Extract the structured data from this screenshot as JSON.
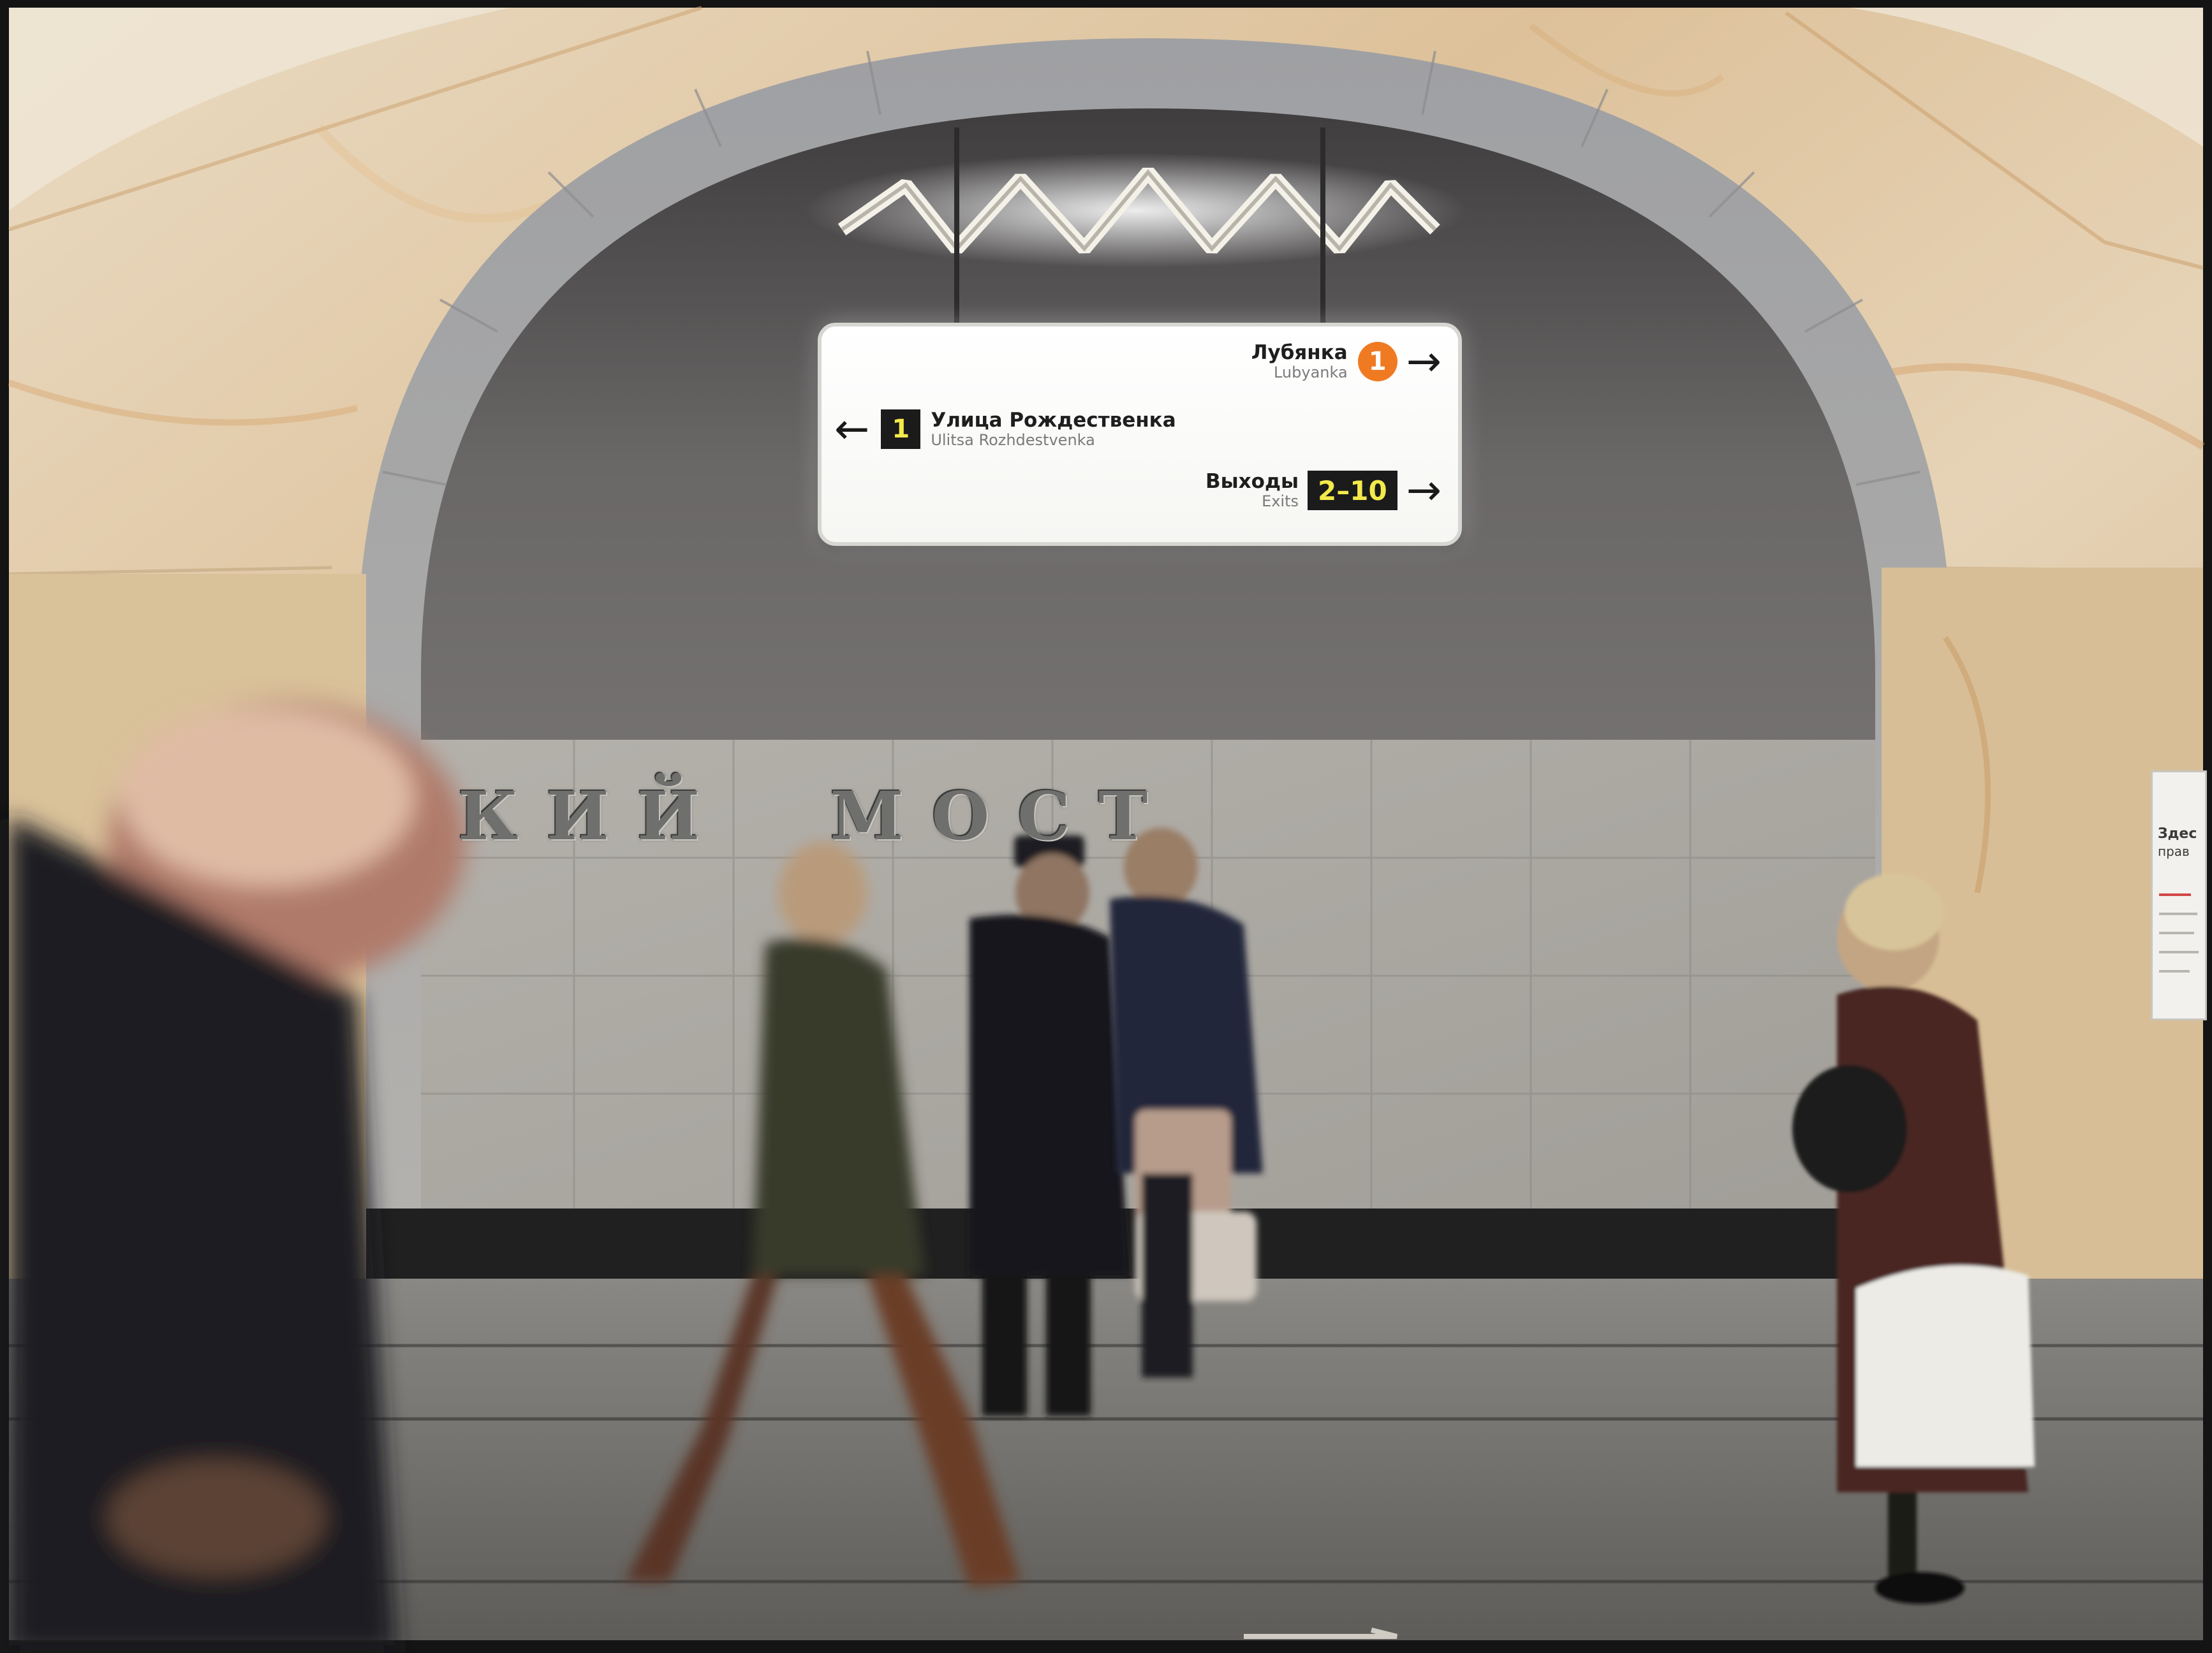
{
  "scene": {
    "description_tags": [
      "metro-station",
      "arch",
      "people-in-motion"
    ]
  },
  "sign": {
    "top": {
      "ru": "Лубянка",
      "en": "Lubyanka",
      "line_number": "1",
      "line_color": "#f07a22",
      "arrow": "→"
    },
    "middle": {
      "ru": "Улица Рождественка",
      "en": "Ulitsa Rozhdestvenka",
      "exit_number": "1",
      "arrow": "←"
    },
    "bottom": {
      "ru": "Выходы",
      "en": "Exits",
      "exit_range": "2–10",
      "arrow": "→"
    }
  },
  "station_wall": {
    "letters": "КИЙ  МОСТ"
  },
  "poster": {
    "title_line1": "Здес",
    "title_line2": "прав"
  },
  "colors": {
    "marble": "#dcc4a0",
    "vault": "#5f5d5d",
    "sign_badge_dark": "#1b1b1b",
    "sign_badge_text": "#f3e94b"
  }
}
